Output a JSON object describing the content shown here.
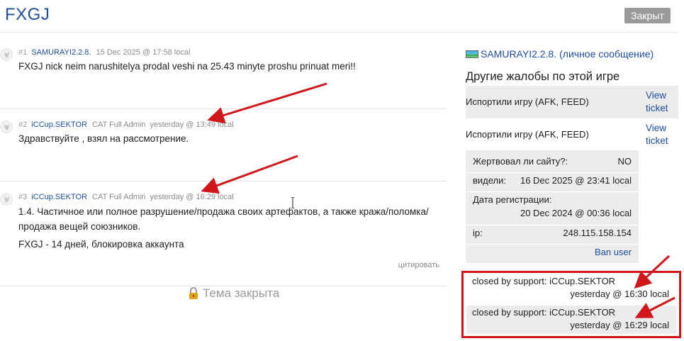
{
  "header": {
    "title": "FXGJ",
    "closed_badge": "Закрыт"
  },
  "posts": [
    {
      "num": "#1",
      "author": "SAMURAYI2.2.8.",
      "role": "",
      "time": "15 Dec 2025 @ 17:58 local",
      "lines": [
        "FXGJ nick neim narushitelya prodal veshi na 25.43 minyte proshu prinuat meri!!"
      ]
    },
    {
      "num": "#2",
      "author": "iCCup.SEKTOR",
      "role": "CAT Full Admin",
      "time": "yesterday @ 13:49 local",
      "lines": [
        "Здравствуйте , взял на рассмотрение."
      ]
    },
    {
      "num": "#3",
      "author": "iCCup.SEKTOR",
      "role": "CAT Full Admin",
      "time": "yesterday @ 16:29 local",
      "lines": [
        "1.4. Частичное или полное разрушение/продажа своих артефактов, а также кража/поломка/ продажа вещей союзников.",
        "FXGJ - 14 дней, блокировка аккаунта"
      ],
      "quote_label": "цитировать"
    }
  ],
  "topic_closed": "Тема закрыта",
  "sidebar": {
    "user": "SAMURAYI2.2.8.",
    "pm_link": "(личное сообщение)",
    "other_complaints_title": "Другие жалобы по этой игре",
    "complaints": [
      {
        "label": "Испортили игру (AFK, FEED)",
        "view": "View ticket"
      },
      {
        "label": "Испортили игру (AFK, FEED)",
        "view": "View ticket"
      }
    ],
    "info": {
      "donated_label": "Жертвовал ли сайту?:",
      "donated_value": "NO",
      "seen_label": "видели:",
      "seen_value": "16 Dec 2025 @ 23:41 local",
      "registered_label": "Дата регистрации:",
      "registered_value": "20 Dec 2024 @ 00:36 local",
      "ip_label": "ip:",
      "ip_value": "248.115.158.154",
      "ban_user": "Ban user"
    },
    "closed_entries": [
      {
        "who": "closed by support: iCCup.SEKTOR",
        "when": "yesterday @ 16:30 local"
      },
      {
        "who": "closed by support: iCCup.SEKTOR",
        "when": "yesterday @ 16:29 local"
      }
    ]
  },
  "colors": {
    "link": "#1f4fa0",
    "annotation_red": "#d0161b",
    "badge_gray": "#9a9a9a"
  }
}
